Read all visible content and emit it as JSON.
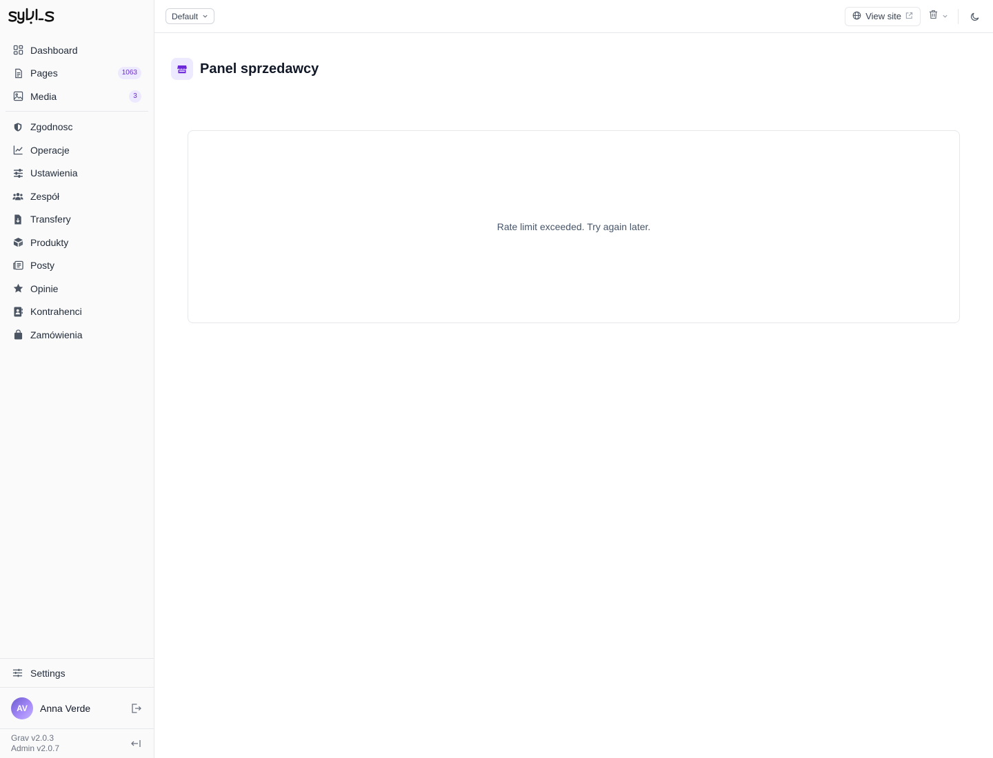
{
  "brand": {
    "logo_icon": "syls-logo"
  },
  "sidebar": {
    "items_top": [
      {
        "label": "Dashboard",
        "icon": "dashboard-icon"
      },
      {
        "label": "Pages",
        "icon": "file-icon",
        "badge": "1063"
      },
      {
        "label": "Media",
        "icon": "image-icon",
        "badge": "3"
      }
    ],
    "items_plugins": [
      {
        "label": "Zgodnosc",
        "icon": "shield-icon"
      },
      {
        "label": "Operacje",
        "icon": "chart-line-icon"
      },
      {
        "label": "Ustawienia",
        "icon": "sliders-icon"
      },
      {
        "label": "Zespół",
        "icon": "users-icon"
      },
      {
        "label": "Transfery",
        "icon": "file-transfer-icon"
      },
      {
        "label": "Produkty",
        "icon": "box-icon"
      },
      {
        "label": "Posty",
        "icon": "newspaper-icon"
      },
      {
        "label": "Opinie",
        "icon": "star-icon"
      },
      {
        "label": "Kontrahenci",
        "icon": "contact-card-icon"
      },
      {
        "label": "Zamówienia",
        "icon": "shopping-bag-icon"
      }
    ],
    "settings_label": "Settings",
    "user": {
      "initials": "AV",
      "name": "Anna Verde"
    },
    "versions": {
      "grav": "Grav v2.0.3",
      "admin": "Admin v2.0.7"
    }
  },
  "topbar": {
    "environment": "Default",
    "view_site_label": "View site"
  },
  "page": {
    "title": "Panel sprzedawcy",
    "message": "Rate limit exceeded. Try again later."
  },
  "colors": {
    "accent": "#6d28d9",
    "accent_bg": "#ede9fe",
    "border": "#e5e7eb"
  }
}
